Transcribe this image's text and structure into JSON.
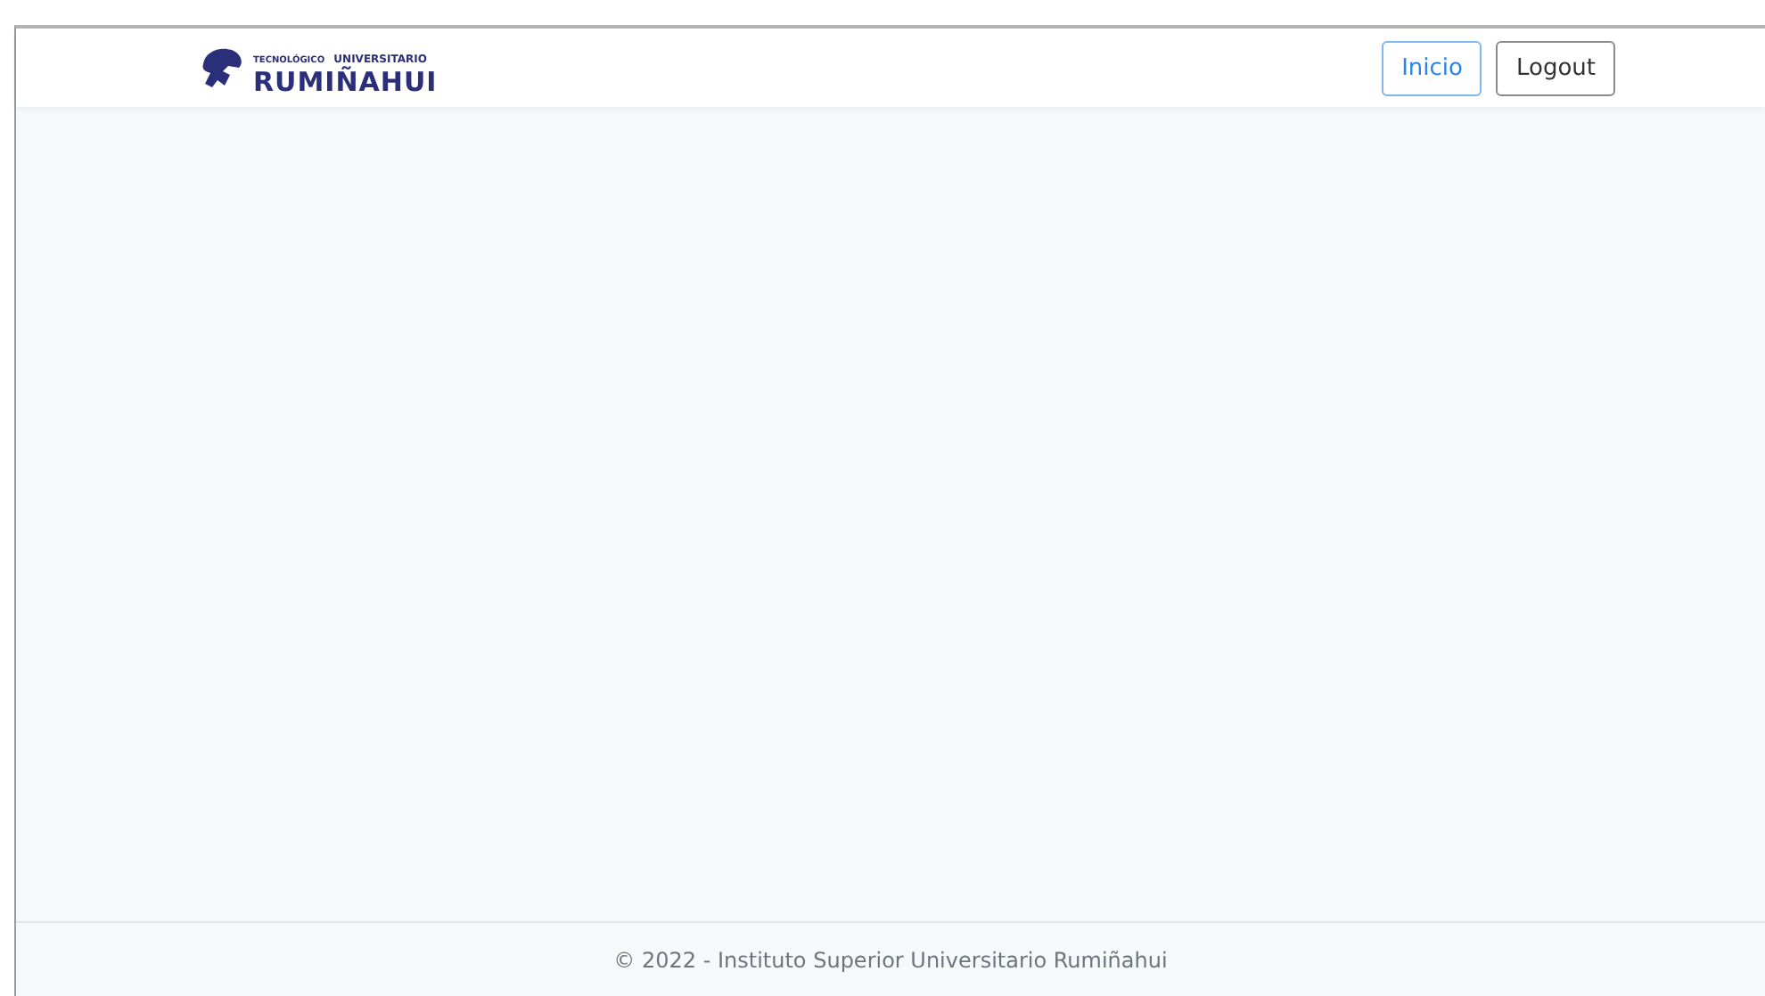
{
  "header": {
    "logo": {
      "top_line_left": "TECNOLÓGICO",
      "top_line_right": "UNIVERSITARIO",
      "name": "RUMIÑAHUI"
    },
    "buttons": [
      {
        "label": "Inicio",
        "kind": "primary"
      },
      {
        "label": "Logout",
        "kind": "secondary"
      }
    ]
  },
  "footer": {
    "text": "© 2022 - Instituto Superior Universitario Rumiñahui"
  }
}
